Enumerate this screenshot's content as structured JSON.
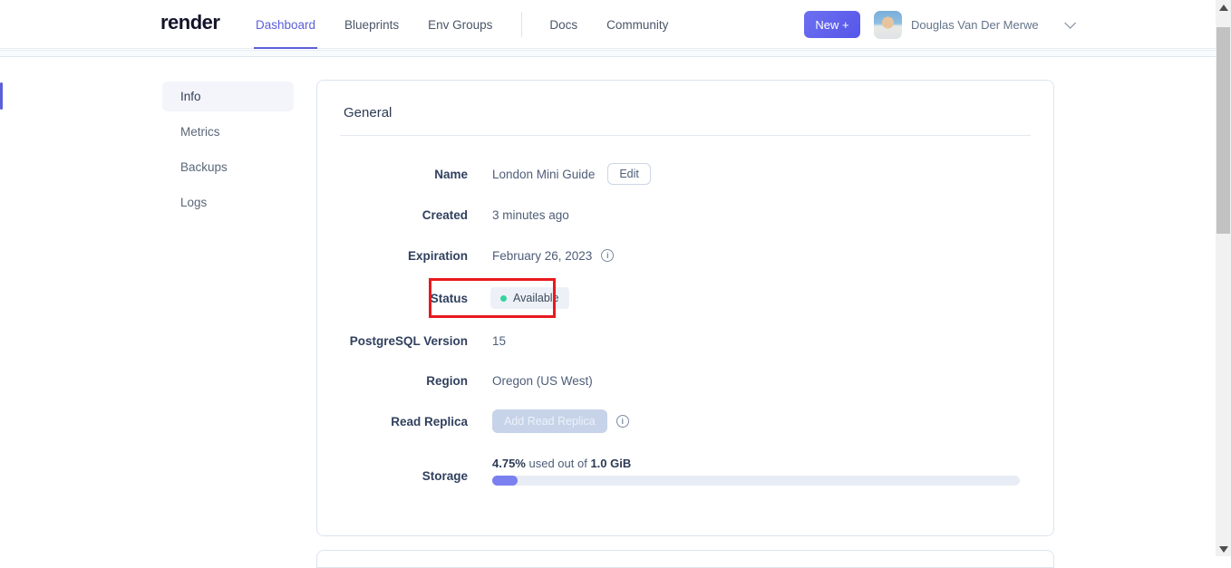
{
  "nav": {
    "logo": "render",
    "links": [
      {
        "label": "Dashboard",
        "active": true
      },
      {
        "label": "Blueprints",
        "active": false
      },
      {
        "label": "Env Groups",
        "active": false
      },
      {
        "label": "Docs",
        "active": false
      },
      {
        "label": "Community",
        "active": false
      }
    ],
    "new_button_label": "New +",
    "user_name": "Douglas Van Der Merwe"
  },
  "sidebar": {
    "items": [
      {
        "label": "Info",
        "active": true
      },
      {
        "label": "Metrics",
        "active": false
      },
      {
        "label": "Backups",
        "active": false
      },
      {
        "label": "Logs",
        "active": false
      }
    ]
  },
  "card": {
    "title": "General",
    "rows": {
      "name": {
        "label": "Name",
        "value": "London Mini Guide",
        "action": "Edit"
      },
      "created": {
        "label": "Created",
        "value": "3 minutes ago"
      },
      "expiration": {
        "label": "Expiration",
        "value": "February 26, 2023"
      },
      "status": {
        "label": "Status",
        "badge": "Available"
      },
      "pg_version": {
        "label": "PostgreSQL Version",
        "value": "15"
      },
      "region": {
        "label": "Region",
        "value": "Oregon (US West)"
      },
      "replica": {
        "label": "Read Replica",
        "button": "Add Read Replica"
      },
      "storage": {
        "label": "Storage",
        "used_pct": "4.75%",
        "middle_text": " used out of ",
        "total": "1.0 GiB",
        "progress_pct": 4.75
      }
    }
  },
  "colors": {
    "accent_purple": "#5b5fd9",
    "highlight_red": "#e8191e",
    "status_dot_green": "#36d39f",
    "progress_fill": "#7a80f0"
  }
}
